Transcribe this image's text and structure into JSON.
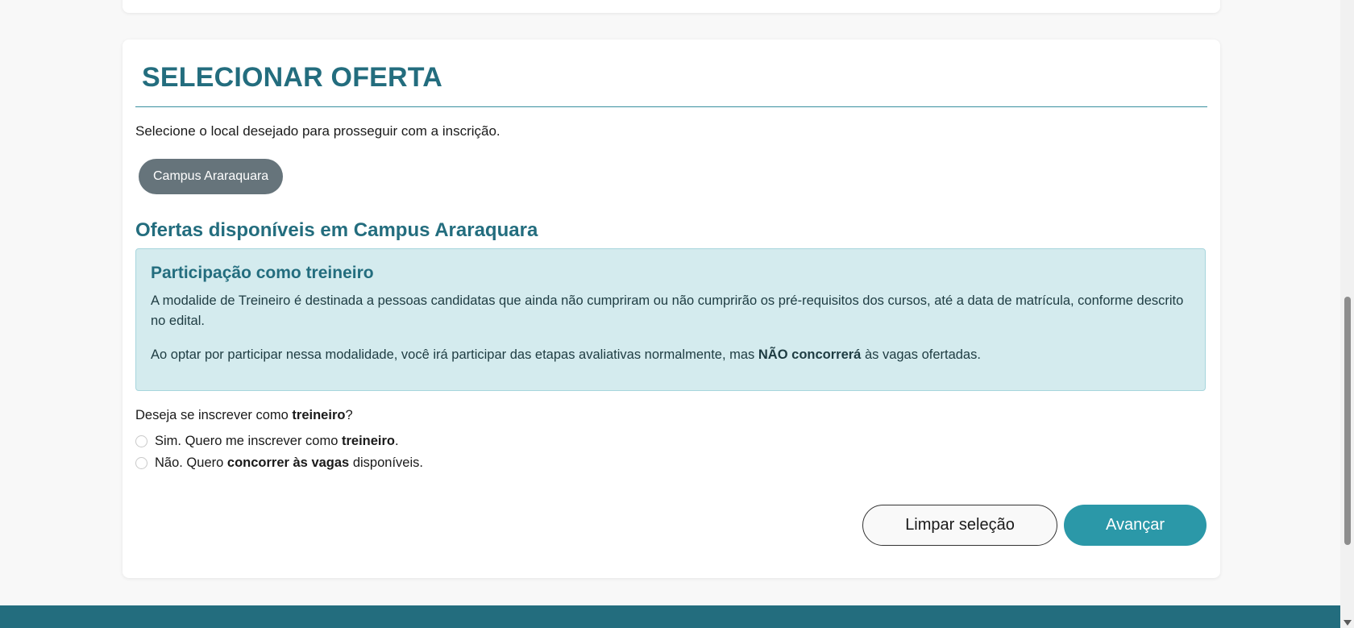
{
  "section": {
    "title": "SELECIONAR OFERTA",
    "intro": "Selecione o local desejado para prosseguir com a inscrição."
  },
  "campus_options": [
    "Campus Araraquara"
  ],
  "offers": {
    "heading": "Ofertas disponíveis em Campus Araraquara"
  },
  "info_box": {
    "title": "Participação como treineiro",
    "paragraph1": "A modalide de Treineiro é destinada a pessoas candidatas que ainda não cumpriram ou não cumprirão os pré-requisitos dos cursos, até a data de matrícula, conforme descrito no edital.",
    "paragraph2_before": "Ao optar por participar nessa modalidade, você irá participar das etapas avaliativas normalmente, mas ",
    "paragraph2_bold": "NÃO concorrerá",
    "paragraph2_after": " às vagas ofertadas."
  },
  "question": {
    "before": "Deseja se inscrever como ",
    "bold": "treineiro",
    "after": "?"
  },
  "radio_options": [
    {
      "before": "Sim. Quero me inscrever como ",
      "bold": "treineiro",
      "after": ".",
      "selected": false
    },
    {
      "before": "Não. Quero ",
      "bold": "concorrer às vagas",
      "after": " disponíveis.",
      "selected": false
    }
  ],
  "buttons": {
    "clear_label": "Limpar seleção",
    "next_label": "Avançar"
  },
  "colors": {
    "accent": "#236d7e",
    "primary_button": "#2b98a8",
    "campus_pill": "#66747b",
    "info_background": "#d4ebee"
  }
}
